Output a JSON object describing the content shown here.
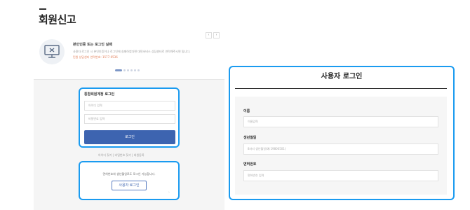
{
  "page": {
    "title": "회원신고"
  },
  "notice": {
    "icon": "monitor-error-icon",
    "title": "본인인증 또는 로그인 실패",
    "line1": "사용자 로그인 시 본인인증이나 로그인에 실패하였다면 대민서비스 상담센터로 연락해주시면 됩니다.",
    "line2": "민원 상담센터 연락번호: 1577-0536",
    "prev_label": "‹",
    "next_label": "›",
    "slide_count": 6,
    "active_slide": 1
  },
  "login": {
    "title": "통합회원계정 로그인",
    "id_placeholder": "아이디 입력",
    "password_placeholder": "비밀번호 입력",
    "button_label": "로그인",
    "links": "아이디 찾기 | 비밀번호 찾기 | 회원등록"
  },
  "alt_login": {
    "text": "면허번호와 생년월일로도 로그인 가능합니다.",
    "button_label": "사용자 로그인",
    "chevron": "›"
  },
  "user_login": {
    "title": "사용자 로그인",
    "name_label": "이름",
    "name_placeholder": "이름입력",
    "birth_label": "생년월일",
    "birth_placeholder": "8자리 생년월일(예:19800501)",
    "license_label": "면허번호",
    "license_placeholder": "면허번호 입력"
  },
  "colors": {
    "highlight": "#1a9bf0",
    "primary": "#3d64b0",
    "warning_text": "#e07b53"
  }
}
